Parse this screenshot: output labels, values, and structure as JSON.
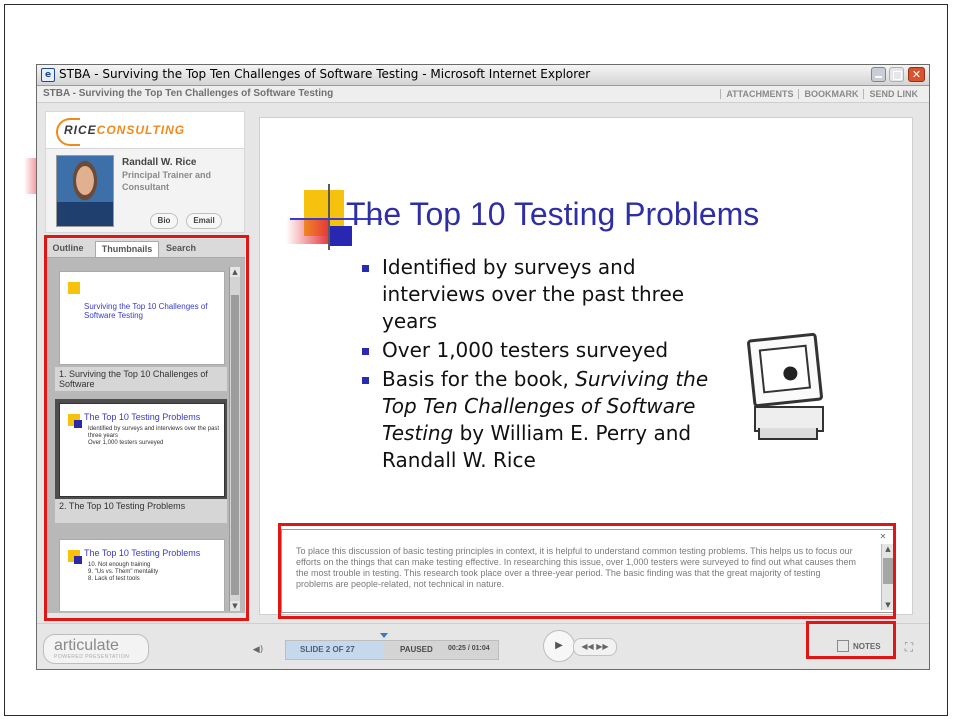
{
  "window": {
    "title": "STBA - Surviving the Top Ten Challenges of Software Testing - Microsoft Internet Explorer"
  },
  "toolbar": {
    "presentation_title": "STBA - Surviving the Top Ten Challenges of Software Testing",
    "links": [
      "ATTACHMENTS",
      "BOOKMARK",
      "SEND LINK"
    ]
  },
  "sidebar": {
    "logo": {
      "part1": "RICE",
      "part2": "CONSULTING"
    },
    "presenter": {
      "name": "Randall W. Rice",
      "role": "Principal Trainer and Consultant",
      "bio_label": "Bio",
      "email_label": "Email"
    },
    "tabs": [
      "Outline",
      "Thumbnails",
      "Search"
    ],
    "selected_tab": "Thumbnails",
    "thumbnails": [
      {
        "caption": "1. Surviving the Top 10 Challenges of Software",
        "mini_title": "Surviving the Top 10 Challenges of Software Testing"
      },
      {
        "caption": "2. The Top 10 Testing Problems",
        "mini_title": "The Top 10 Testing Problems",
        "selected": true
      },
      {
        "caption": "",
        "mini_title": "The Top 10 Testing Problems",
        "mini_lines": [
          "10. Not enough training",
          "9. \"Us vs. Them\" mentality",
          "8. Lack of test tools"
        ]
      }
    ]
  },
  "slide": {
    "title": "The Top 10 Testing Problems",
    "bullets": [
      {
        "text": "Identified by surveys and interviews over the past three years"
      },
      {
        "text": "Over 1,000 testers surveyed"
      },
      {
        "before": "Basis for the book, ",
        "italic": "Surviving the Top Ten Challenges of Software Testing",
        "after": " by William E. Perry and Randall W. Rice"
      }
    ]
  },
  "notes": {
    "text": "To place this discussion of basic testing principles in context, it is helpful to understand common testing problems. This helps us to focus our efforts on the things that can make testing effective.  In researching this issue, over 1,000 testers were surveyed to find out what causes them the most trouble in testing. This research took place over a three-year period.  The basic finding was that the great majority of testing problems are people-related, not technical in nature."
  },
  "player": {
    "logo_main": "articulate",
    "logo_sub": "POWERED PRESENTATION",
    "slide_counter": "SLIDE 2 OF 27",
    "status": "PAUSED",
    "time": "00:25 / 01:04",
    "notes_label": "NOTES",
    "progress_fraction": 0.46
  },
  "colors": {
    "highlight": "#e01616",
    "slide_title": "#2f2fa3",
    "bullet": "#2a2ab0",
    "logo_orange": "#f08a1c"
  }
}
